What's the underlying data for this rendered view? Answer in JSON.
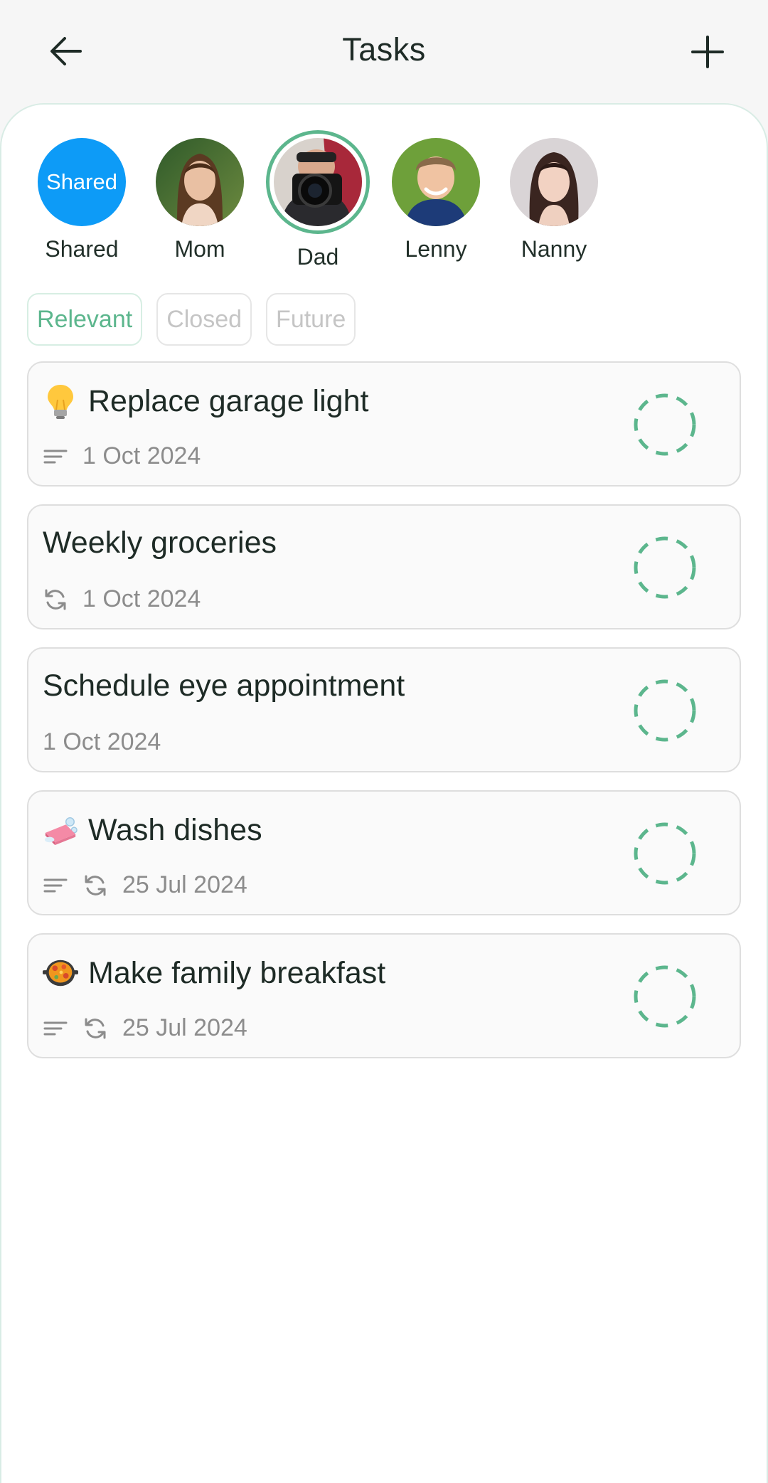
{
  "header": {
    "title": "Tasks",
    "back_icon": "arrow-left-icon",
    "add_icon": "plus-icon"
  },
  "people": [
    {
      "name": "Shared",
      "avatar_text": "Shared",
      "color": "#0d9bf7",
      "selected": false
    },
    {
      "name": "Mom",
      "selected": false
    },
    {
      "name": "Dad",
      "selected": true
    },
    {
      "name": "Lenny",
      "selected": false
    },
    {
      "name": "Nanny",
      "selected": false
    }
  ],
  "filters": [
    {
      "label": "Relevant",
      "active": true
    },
    {
      "label": "Closed",
      "active": false
    },
    {
      "label": "Future",
      "active": false
    }
  ],
  "tasks": [
    {
      "title": "Replace garage light",
      "emoji": "light-bulb",
      "has_description": true,
      "recurring": false,
      "date": "1 Oct 2024",
      "done": false
    },
    {
      "title": "Weekly groceries",
      "emoji": "",
      "has_description": false,
      "recurring": true,
      "date": "1 Oct 2024",
      "done": false
    },
    {
      "title": "Schedule eye appointment",
      "emoji": "",
      "has_description": false,
      "recurring": false,
      "date": "1 Oct 2024",
      "done": false
    },
    {
      "title": "Wash dishes",
      "emoji": "soap",
      "has_description": true,
      "recurring": true,
      "date": "25 Jul 2024",
      "done": false
    },
    {
      "title": "Make family breakfast",
      "emoji": "paella-pan",
      "has_description": true,
      "recurring": true,
      "date": "25 Jul 2024",
      "done": false
    }
  ],
  "colors": {
    "accent": "#5cb68d",
    "shared_avatar": "#0d9bf7",
    "text": "#1e2b26",
    "muted": "#8c8c8c"
  }
}
